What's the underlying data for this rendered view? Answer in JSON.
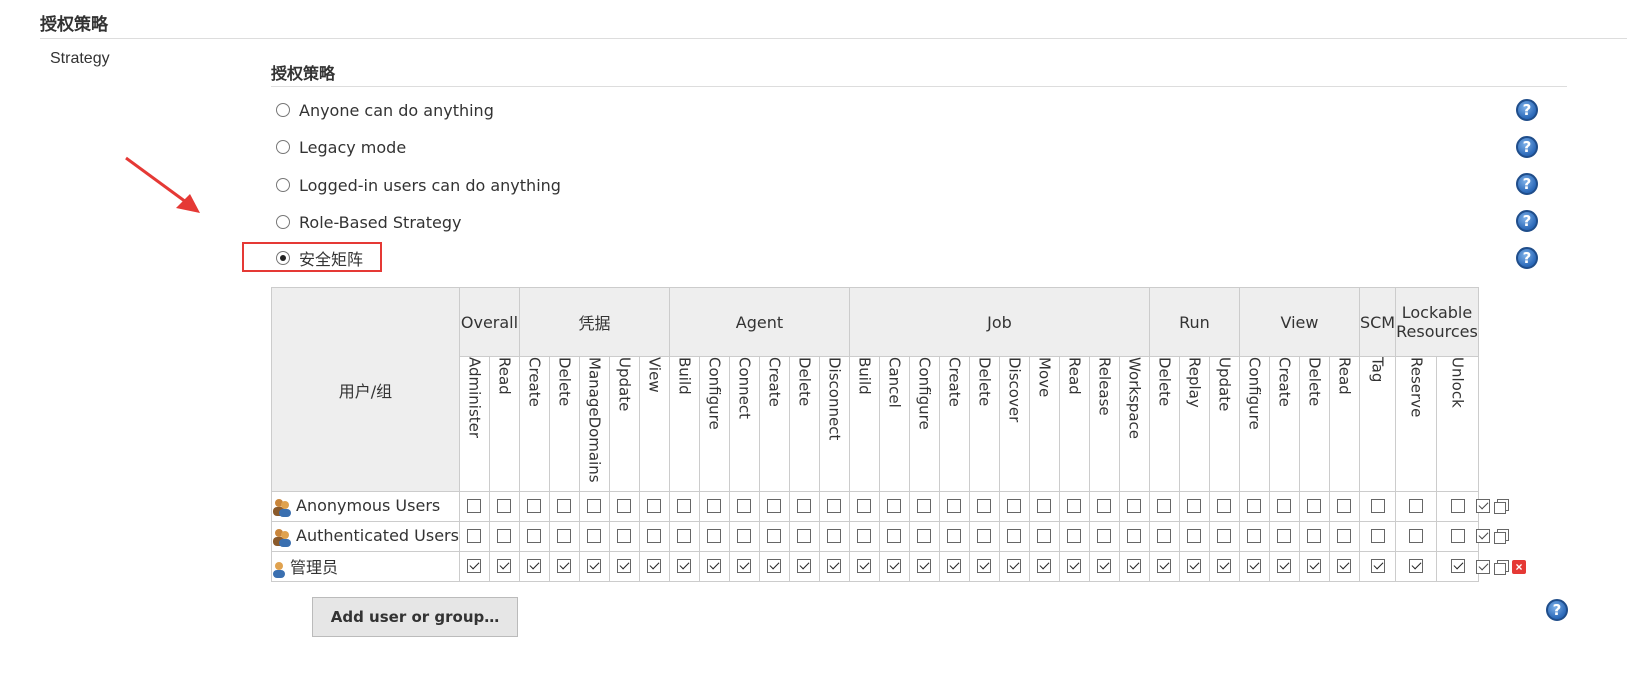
{
  "section": {
    "title": "授权策略",
    "label": "Strategy"
  },
  "strategy": {
    "title": "授权策略",
    "options": [
      {
        "label": "Anyone can do anything",
        "selected": false
      },
      {
        "label": "Legacy mode",
        "selected": false
      },
      {
        "label": "Logged-in users can do anything",
        "selected": false
      },
      {
        "label": "Role-Based Strategy",
        "selected": false
      },
      {
        "label": "安全矩阵",
        "selected": true
      }
    ],
    "help_glyph": "?"
  },
  "matrix": {
    "user_group_header": "用户/组",
    "groups": [
      {
        "name": "Overall",
        "perms": [
          "Administer",
          "Read"
        ]
      },
      {
        "name": "凭据",
        "perms": [
          "Create",
          "Delete",
          "ManageDomains",
          "Update",
          "View"
        ]
      },
      {
        "name": "Agent",
        "perms": [
          "Build",
          "Configure",
          "Connect",
          "Create",
          "Delete",
          "Disconnect"
        ]
      },
      {
        "name": "Job",
        "perms": [
          "Build",
          "Cancel",
          "Configure",
          "Create",
          "Delete",
          "Discover",
          "Move",
          "Read",
          "Release",
          "Workspace"
        ]
      },
      {
        "name": "Run",
        "perms": [
          "Delete",
          "Replay",
          "Update"
        ]
      },
      {
        "name": "View",
        "perms": [
          "Configure",
          "Create",
          "Delete",
          "Read"
        ]
      },
      {
        "name": "SCM",
        "perms": [
          "Tag"
        ]
      },
      {
        "name": "Lockable Resources",
        "perms": [
          "Reserve",
          "Unlock"
        ]
      }
    ],
    "rows": [
      {
        "name": "Anonymous Users",
        "icon": "group-icon",
        "all_checked": false,
        "deletable": false
      },
      {
        "name": "Authenticated Users",
        "icon": "group-icon",
        "all_checked": false,
        "deletable": false
      },
      {
        "name": "管理员",
        "icon": "user-icon",
        "all_checked": true,
        "deletable": true
      }
    ]
  },
  "add_button": {
    "label": "Add user or group…"
  },
  "colors": {
    "highlight": "#e53935",
    "help": "#2a68b8",
    "header_bg": "#eeeeee"
  }
}
